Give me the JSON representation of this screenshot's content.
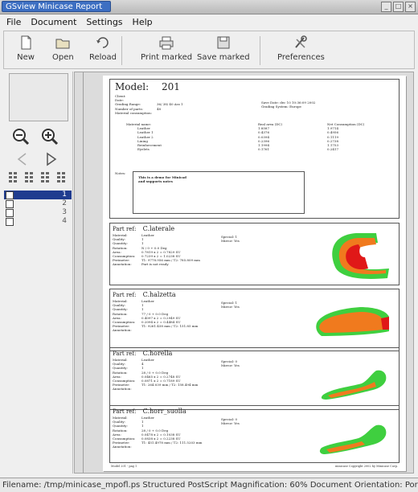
{
  "window": {
    "title": "GSview Minicase Report",
    "buttons": [
      "_",
      "□",
      "×"
    ]
  },
  "menu": {
    "file": "File",
    "document": "Document",
    "settings": "Settings",
    "help": "Help"
  },
  "toolbar": {
    "new": "New",
    "open": "Open",
    "reload": "Reload",
    "print_marked": "Print marked",
    "save_marked": "Save marked",
    "preferences": "Preferences"
  },
  "sidebar": {
    "pages": [
      {
        "num": "1",
        "selected": true
      },
      {
        "num": "2",
        "selected": false
      },
      {
        "num": "3",
        "selected": false
      },
      {
        "num": "4",
        "selected": false
      }
    ]
  },
  "report": {
    "model_label": "Model:",
    "model_value": "201",
    "info": [
      {
        "k": "Client:",
        "v": ""
      },
      {
        "k": "Date:",
        "v": ""
      },
      {
        "k": "Grading Range:",
        "v": "36/ 38/ 40 Ass 1"
      },
      {
        "k": "Number of parts:",
        "v": "48"
      },
      {
        "k": "Material consumption:",
        "v": ""
      }
    ],
    "right_info": [
      "Save Date: dec 10 10:36:09 2002",
      "Grading System: Europe"
    ],
    "material_header": [
      "Material name:",
      "Real area (DC)",
      "Net Consumption (DC)"
    ],
    "materials": [
      [
        "Leather",
        "1.8587",
        "1.9714"
      ],
      [
        "Leather 1",
        "0.4376",
        "0.4956"
      ],
      [
        "Leather 2",
        "0.0394",
        "0.1119"
      ],
      [
        "Lining",
        "0.2396",
        "0.2738"
      ],
      [
        "Reinforcement",
        "1.1994",
        "1.1753"
      ],
      [
        "Eyelets",
        "0.1761",
        "0.2417"
      ]
    ],
    "notes_label": "Notes:",
    "notes_text": [
      "This is a demo for Minicad",
      "and supports notes"
    ],
    "parts": [
      {
        "name": "C.laterale",
        "rows": [
          [
            "Material:",
            "Leather"
          ],
          [
            "Quality:",
            "1"
          ],
          [
            "Quantity:",
            "1"
          ],
          [
            "Rotation:",
            "N / 0 + 0.0 Deg"
          ],
          [
            "Area:",
            "0.7819 x 2 = 0.7829 SU"
          ],
          [
            "Consumption:",
            "0.7239 x 2 = 1.0238 SU"
          ],
          [
            "Perimeter:",
            "T1: 9778.956 mm / T2: 785.809 mm"
          ],
          [
            "Annotation:",
            "Part is not ready"
          ]
        ],
        "side": [
          "Special: 1",
          "Mirror: Yes"
        ]
      },
      {
        "name": "C.halzetta",
        "rows": [
          [
            "Material:",
            "Leather"
          ],
          [
            "Quality:",
            "1"
          ],
          [
            "Quantity:",
            "1"
          ],
          [
            "Rotation:",
            "77 / 0 + 0.0 Deg"
          ],
          [
            "Area:",
            "0.4097 x 2 = 0.2949 SU"
          ],
          [
            "Consumption:",
            "0.2094 x 2 = 0.4484 SU"
          ],
          [
            "Perimeter:",
            "T1: 9261.458 mm / T2: 151.85 mm"
          ],
          [
            "Annotation:",
            ""
          ]
        ],
        "side": [
          "Special: 1",
          "Mirror: Yes"
        ]
      },
      {
        "name": "C.horella",
        "rows": [
          [
            "Material:",
            "Leather"
          ],
          [
            "Quality:",
            "4"
          ],
          [
            "Quantity:",
            "1"
          ],
          [
            "Rotation:",
            "28 / 0 + 0.0 Deg"
          ],
          [
            "Area:",
            "0.0465 x 2 = 0.2748 SU"
          ],
          [
            "Consumption:",
            "0.0871 x 2 = 0.7189 SU"
          ],
          [
            "Perimeter:",
            "T1: 264.039 mm / T2: 158.494 mm"
          ],
          [
            "Annotation:",
            ""
          ]
        ],
        "side": [
          "Special: 0",
          "Mirror: Yes"
        ]
      },
      {
        "name": "C.horr_suolla",
        "rows": [
          [
            "Material:",
            "Leather"
          ],
          [
            "Quality:",
            "1"
          ],
          [
            "Quantity:",
            "1"
          ],
          [
            "Rotation:",
            "28 / 0 + 0.0 Deg"
          ],
          [
            "Area:",
            "0.0478 x 2 = 0.1038 SU"
          ],
          [
            "Consumption:",
            "0.0838 x 2 = 0.2238 SU"
          ],
          [
            "Perimeter:",
            "T1: 451.4978 mm / T2: 111.5203 mm"
          ],
          [
            "Annotation:",
            ""
          ]
        ],
        "side": [
          "Special: 0",
          "Mirror: Yes"
        ]
      }
    ],
    "footer_left": "Model 201 - pag 1",
    "footer_right": "minicase Copyright 2002 by Minicase Corp."
  },
  "status": {
    "text": "Filename: /tmp/minicase_mpofl.ps Structured PostScript Magnification: 60% Document Orientation: Portrait D"
  },
  "colors": {
    "piece_green": "#3fcf3f",
    "piece_orange": "#f07a1e",
    "piece_red": "#e01818",
    "selection": "#1f3c8f"
  }
}
